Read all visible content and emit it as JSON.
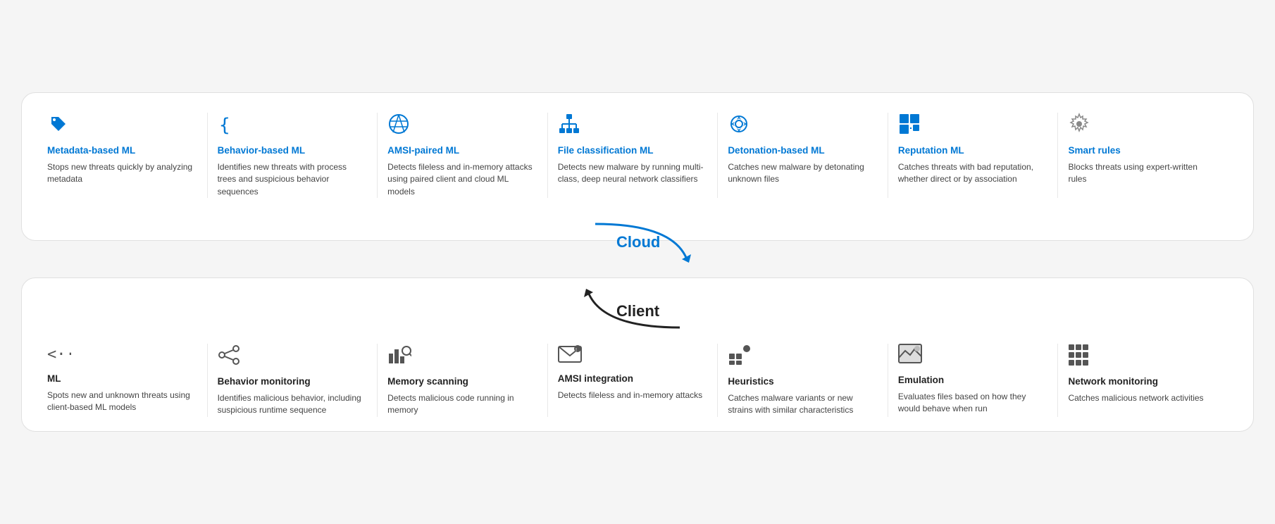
{
  "cloud_panel": {
    "items": [
      {
        "id": "metadata-ml",
        "icon": "tag",
        "title": "Metadata-based ML",
        "desc": "Stops new threats quickly by analyzing metadata",
        "title_color": "#0078d4"
      },
      {
        "id": "behavior-ml",
        "icon": "braces",
        "title": "Behavior-based ML",
        "desc": "Identifies new threats with process trees and suspicious behavior sequences",
        "title_color": "#0078d4"
      },
      {
        "id": "amsi-ml",
        "icon": "network",
        "title": "AMSI-paired ML",
        "desc": "Detects fileless and in-memory attacks using paired client and cloud ML models",
        "title_color": "#0078d4"
      },
      {
        "id": "file-class-ml",
        "icon": "hierarchy",
        "title": "File classification ML",
        "desc": "Detects new malware by running multi-class, deep neural network classifiers",
        "title_color": "#0078d4"
      },
      {
        "id": "detonation-ml",
        "icon": "crosshair",
        "title": "Detonation-based ML",
        "desc": "Catches new malware by detonating unknown files",
        "title_color": "#0078d4"
      },
      {
        "id": "reputation-ml",
        "icon": "squares",
        "title": "Reputation ML",
        "desc": "Catches threats with bad reputation, whether direct or by association",
        "title_color": "#0078d4"
      },
      {
        "id": "smart-rules",
        "icon": "gear",
        "title": "Smart rules",
        "desc": "Blocks threats using expert-written rules",
        "title_color": "#0078d4"
      }
    ]
  },
  "connector_cloud": {
    "label": "Cloud",
    "arrow_direction": "down-right"
  },
  "connector_client": {
    "label": "Client",
    "arrow_direction": "up-left"
  },
  "client_panel": {
    "items": [
      {
        "id": "client-ml",
        "icon": "arrows-lr",
        "title": "ML",
        "desc": "Spots new and unknown threats using client-based ML models",
        "title_color": "#222"
      },
      {
        "id": "behavior-monitoring",
        "icon": "share",
        "title": "Behavior monitoring",
        "desc": "Identifies malicious behavior, including suspicious runtime sequence",
        "title_color": "#222"
      },
      {
        "id": "memory-scanning",
        "icon": "chart-search",
        "title": "Memory scanning",
        "desc": "Detects malicious code running in memory",
        "title_color": "#222"
      },
      {
        "id": "amsi-integration",
        "icon": "envelope",
        "title": "AMSI integration",
        "desc": "Detects fileless and in-memory attacks",
        "title_color": "#222"
      },
      {
        "id": "heuristics",
        "icon": "dots-square",
        "title": "Heuristics",
        "desc": "Catches malware variants or new strains with similar characteristics",
        "title_color": "#222"
      },
      {
        "id": "emulation",
        "icon": "landscape",
        "title": "Emulation",
        "desc": "Evaluates files based on how they would behave when run",
        "title_color": "#222"
      },
      {
        "id": "network-monitoring",
        "icon": "grid",
        "title": "Network monitoring",
        "desc": "Catches malicious network activities",
        "title_color": "#222"
      }
    ]
  }
}
